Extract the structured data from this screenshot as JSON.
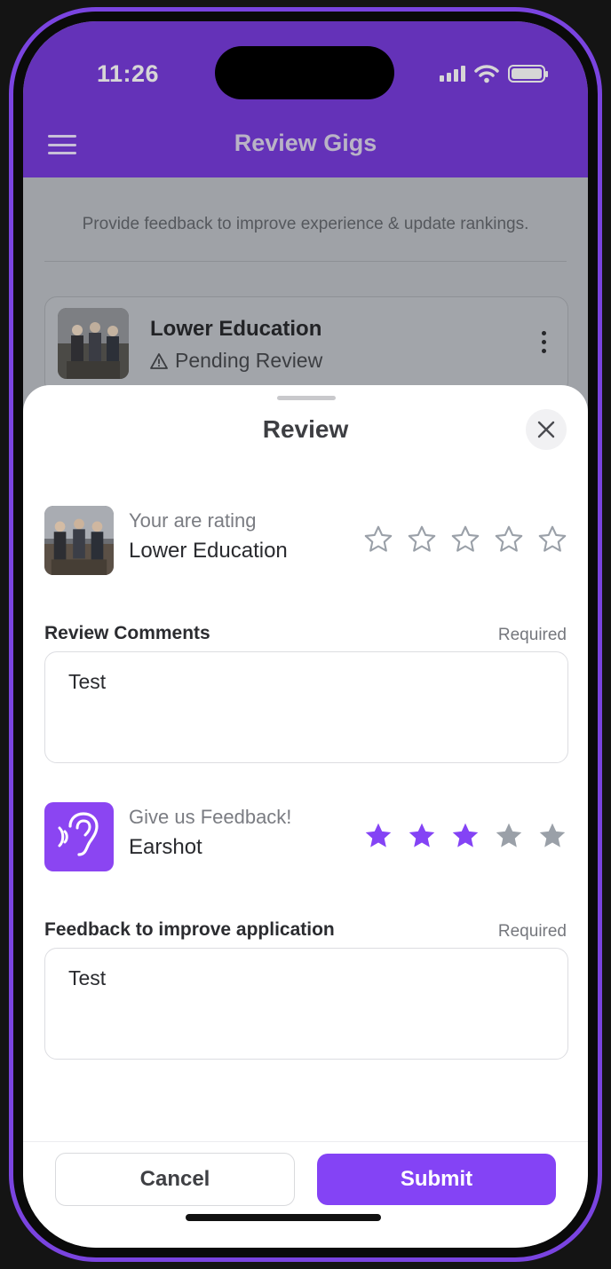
{
  "status_bar": {
    "time": "11:26"
  },
  "header": {
    "title": "Review Gigs"
  },
  "page": {
    "subtitle": "Provide feedback to improve experience & update rankings."
  },
  "gig_card": {
    "name": "Lower Education",
    "status": "Pending Review"
  },
  "sheet": {
    "title": "Review",
    "gig_rating": {
      "kicker": "Your are rating",
      "name": "Lower Education",
      "rating": 0,
      "max": 5
    },
    "review_comments": {
      "label": "Review Comments",
      "required": "Required",
      "value": "Test"
    },
    "app_rating": {
      "kicker": "Give us Feedback!",
      "name": "Earshot",
      "rating": 3,
      "max": 5
    },
    "feedback": {
      "label": "Feedback to improve application",
      "required": "Required",
      "value": "Test"
    },
    "buttons": {
      "cancel": "Cancel",
      "submit": "Submit"
    }
  },
  "colors": {
    "accent": "#8443f5",
    "header_dimmed": "#6432b8",
    "star_empty": "#9aa0a8"
  },
  "icons": [
    "menu-icon",
    "warning-icon",
    "kebab-icon",
    "close-icon",
    "star-outline-icon",
    "star-filled-icon",
    "ear-sound-icon"
  ]
}
